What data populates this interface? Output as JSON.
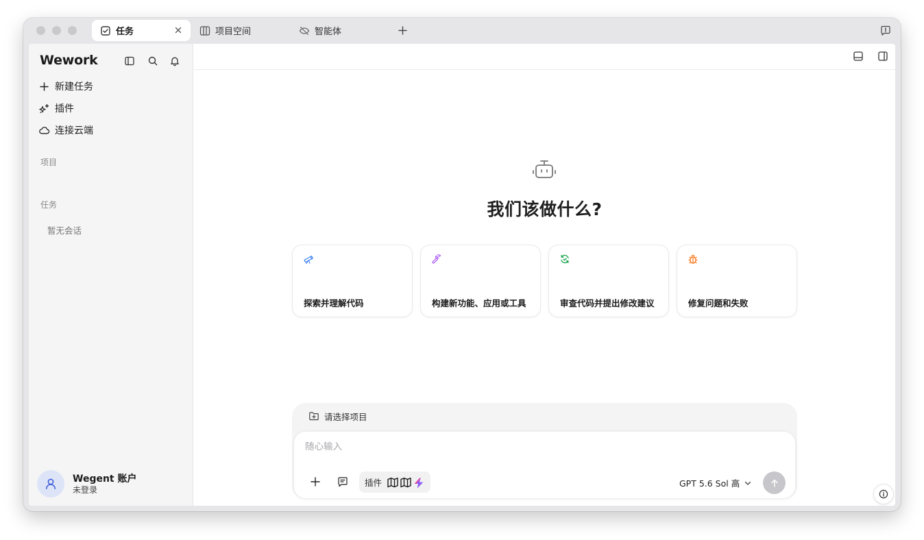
{
  "window": {
    "tabs": [
      {
        "label": "任务",
        "icon": "checkbox-icon",
        "active": true
      },
      {
        "label": "项目空间",
        "icon": "columns-icon",
        "active": false
      },
      {
        "label": "智能体",
        "icon": "eye-off-icon",
        "active": false
      }
    ],
    "new_tab_icon": "plus-icon",
    "feedback_icon": "feedback-icon"
  },
  "sidebar": {
    "brand": "Wework",
    "toolbar_icons": [
      "sidebar-toggle-icon",
      "search-icon",
      "bell-icon"
    ],
    "nav": [
      {
        "label": "新建任务",
        "icon": "plus-icon"
      },
      {
        "label": "插件",
        "icon": "sparkles-icon"
      },
      {
        "label": "连接云端",
        "icon": "cloud-icon"
      }
    ],
    "sections": {
      "projects_label": "项目",
      "tasks_label": "任务",
      "tasks_empty": "暂无会话"
    },
    "account": {
      "name": "Wegent 账户",
      "status": "未登录",
      "avatar_icon": "user-icon"
    }
  },
  "main": {
    "topbar_icons": [
      "panel-bottom-icon",
      "panel-right-icon"
    ],
    "hero": {
      "icon": "robot-icon",
      "title": "我们该做什么?"
    },
    "cards": [
      {
        "label": "探索并理解代码",
        "icon": "telescope-icon",
        "color": "#3b82f6"
      },
      {
        "label": "构建新功能、应用或工具",
        "icon": "hammer-icon",
        "color": "#a855f7"
      },
      {
        "label": "审查代码并提出修改建议",
        "icon": "review-icon",
        "color": "#16a34a"
      },
      {
        "label": "修复问题和失败",
        "icon": "bug-icon",
        "color": "#f97316"
      }
    ],
    "composer": {
      "project_label": "请选择项目",
      "placeholder": "随心输入",
      "plugin_label": "插件",
      "model": "GPT 5.6 Sol 高",
      "send_icon": "arrow-up-icon"
    },
    "info_icon": "info-icon"
  },
  "colors": {
    "accent_purple": "#8b5cf6",
    "send_disabled": "#c7c7cb",
    "sidebar_bg": "#f5f5f6"
  }
}
